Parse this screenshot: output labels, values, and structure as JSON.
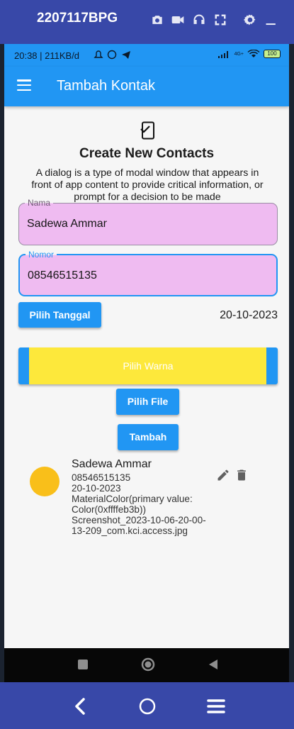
{
  "window": {
    "title": "2207117BPG",
    "icons": [
      "camera-icon",
      "video-icon",
      "headphones-icon",
      "fullscreen-icon",
      "settings-icon",
      "minimize-icon"
    ]
  },
  "status_bar": {
    "left_text": "20:38 | 211KB/d",
    "network_label": "4G+",
    "battery": "100"
  },
  "app_bar": {
    "title": "Tambah Kontak",
    "menu_icon": "menu-icon"
  },
  "header": {
    "icon": "phone-check-icon",
    "title": "Create New Contacts",
    "description": "A dialog is a type of modal window that appears in front of app content to provide critical information, or prompt for a decision to be made"
  },
  "form": {
    "nama": {
      "label": "Nama",
      "value": "Sadewa Ammar"
    },
    "nomor": {
      "label": "Nomor",
      "value": "08546515135"
    },
    "date_button": "Pilih Tanggal",
    "date_value": "20-10-2023",
    "color_button": "Pilih Warna",
    "selected_color": "#fde83b",
    "file_button": "Pilih File",
    "submit_button": "Tambah"
  },
  "contacts": [
    {
      "name": "Sadewa Ammar",
      "phone": "08546515135",
      "date": "20-10-2023",
      "color_text": " MaterialColor(primary value: Color(0xffffeb3b))",
      "file": "Screenshot_2023-10-06-20-00-13-209_com.kci.access.jpg",
      "avatar_color": "#f9bf1a"
    }
  ],
  "colors": {
    "primary": "#2196f3",
    "field_fill": "#efbbf1",
    "window_chrome": "#3848a8"
  }
}
